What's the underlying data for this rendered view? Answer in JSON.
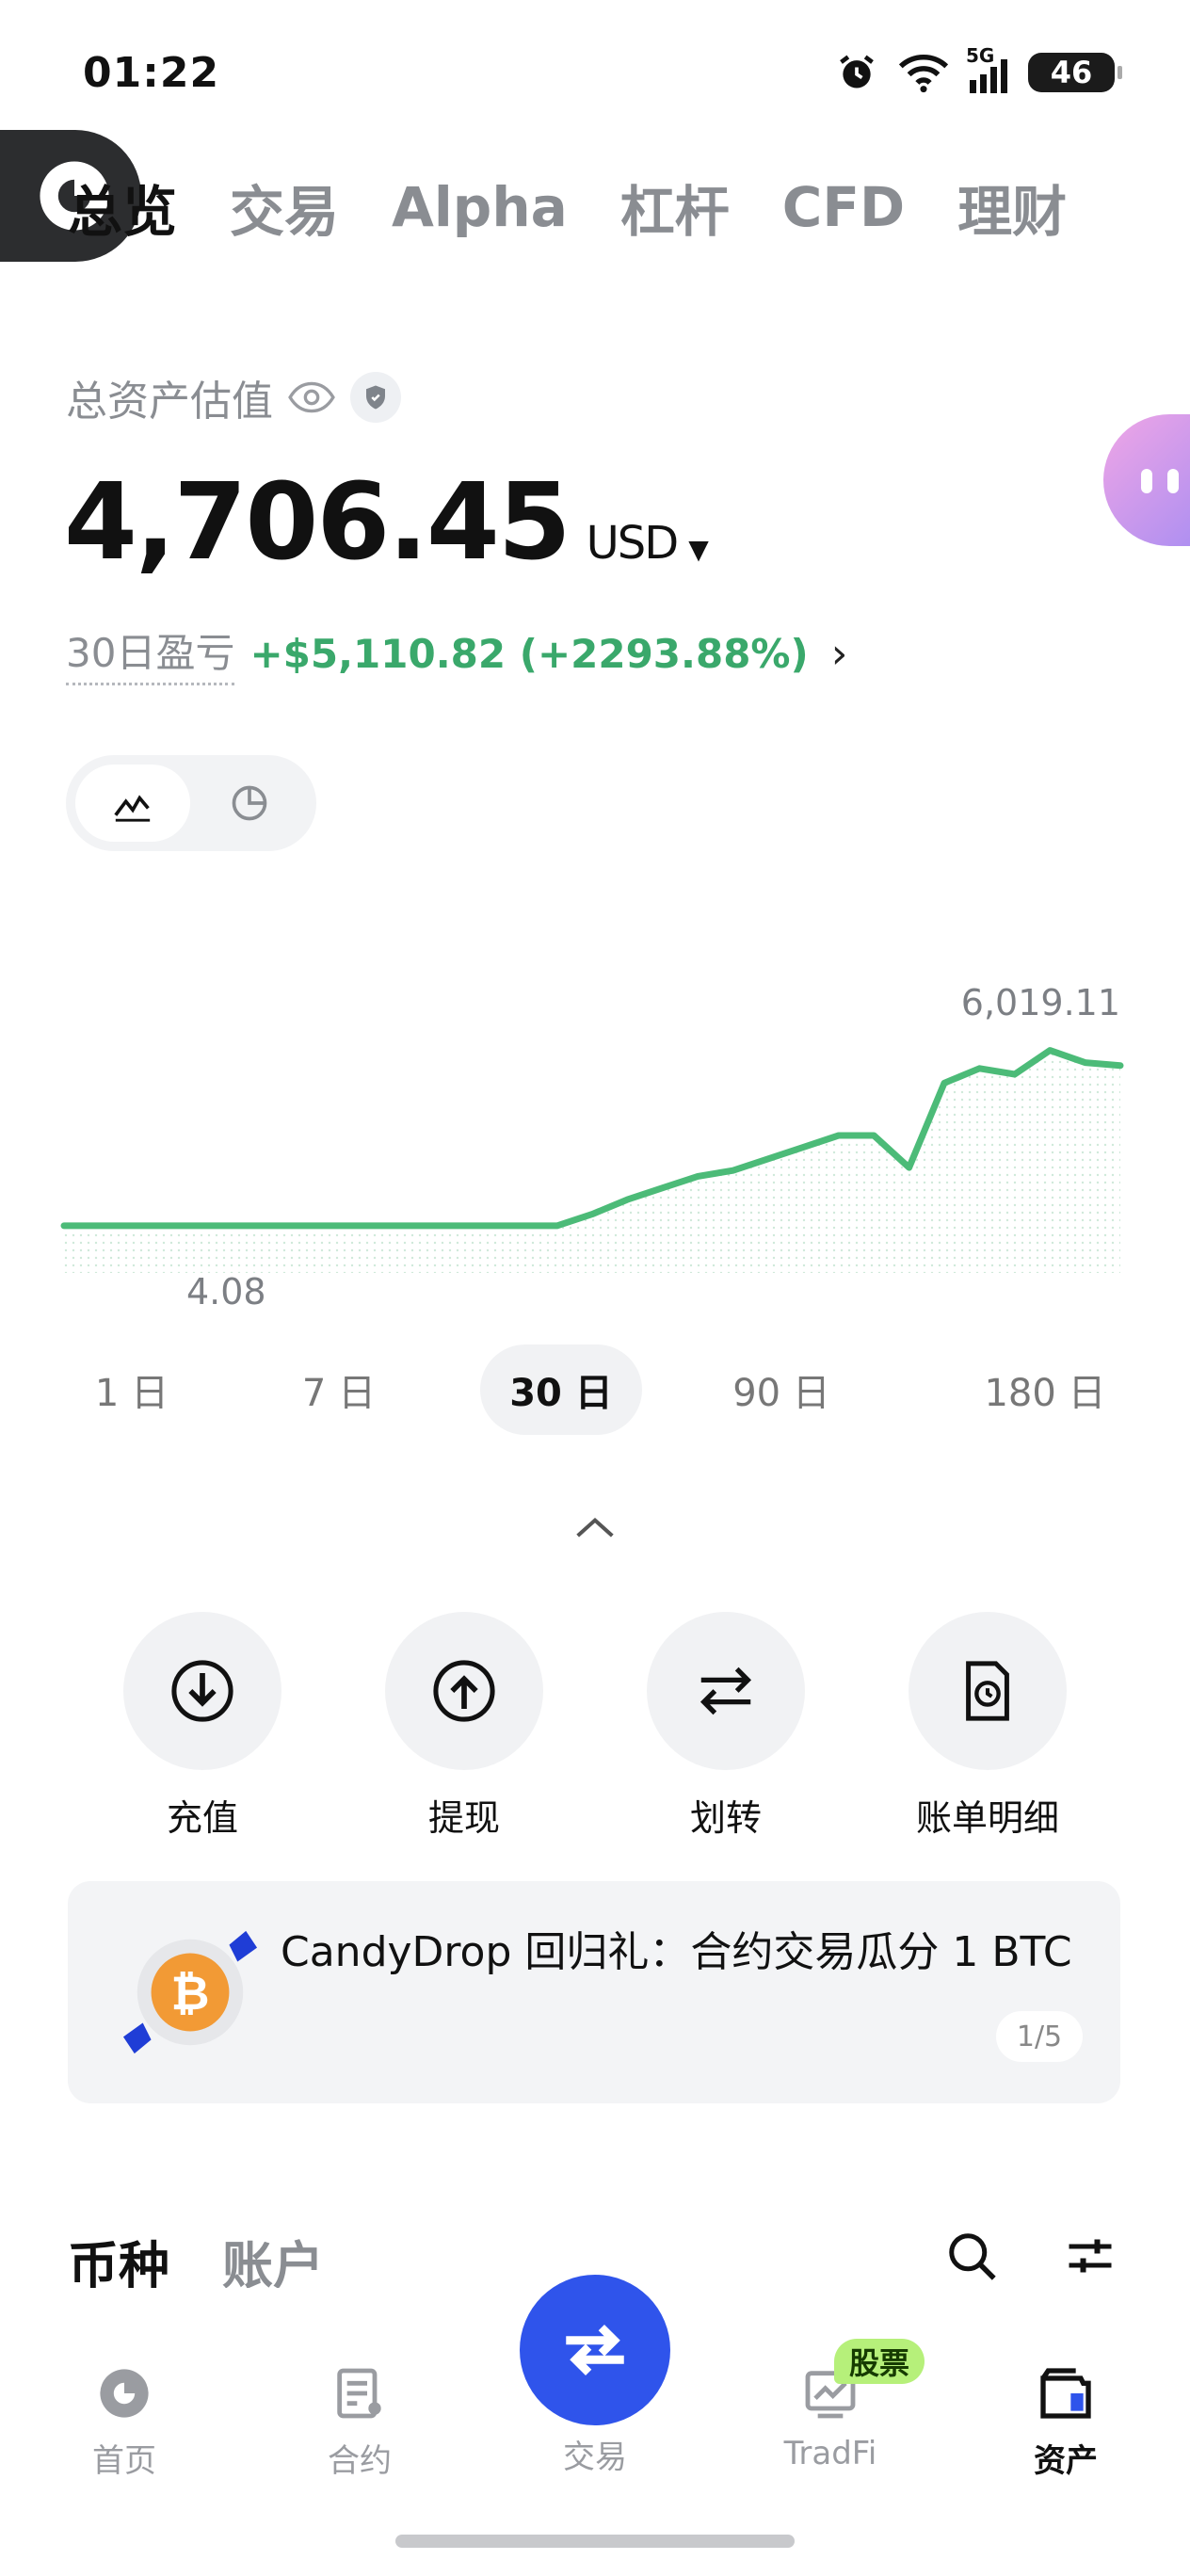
{
  "status_bar": {
    "time": "01:22",
    "network": "5G",
    "battery": "46"
  },
  "top_tabs": [
    {
      "label": "总览",
      "active": true
    },
    {
      "label": "交易",
      "active": false
    },
    {
      "label": "Alpha",
      "active": false
    },
    {
      "label": "杠杆",
      "active": false
    },
    {
      "label": "CFD",
      "active": false
    },
    {
      "label": "理财",
      "active": false
    }
  ],
  "asset": {
    "title": "总资产估值",
    "amount": "4,706.45",
    "currency": "USD",
    "pnl_label": "30日盈亏",
    "pnl_value": "+$5,110.82 (+2293.88%)"
  },
  "chart": {
    "max_label": "6,019.11",
    "min_label": "4.08",
    "line_color": "#4cbb78"
  },
  "chart_data": {
    "type": "line",
    "x": [
      0,
      1,
      2,
      3,
      4,
      5,
      6,
      7,
      8,
      9,
      10,
      11,
      12,
      13,
      14,
      15,
      16,
      17,
      18,
      19,
      20,
      21,
      22,
      23,
      24,
      25,
      26,
      27,
      28,
      29,
      30
    ],
    "values": [
      4.08,
      4.08,
      4.08,
      4.08,
      4.08,
      4.08,
      4.08,
      4.08,
      4.08,
      4.08,
      4.08,
      4.08,
      4.08,
      4.08,
      4.08,
      400,
      900,
      1300,
      1700,
      1900,
      2300,
      2700,
      3100,
      3100,
      2000,
      4900,
      5400,
      5200,
      6019.11,
      5600,
      5500
    ],
    "ylim": [
      0,
      6200
    ],
    "grid": false
  },
  "periods": [
    {
      "label": "1 日",
      "active": false
    },
    {
      "label": "7 日",
      "active": false
    },
    {
      "label": "30 日",
      "active": true
    },
    {
      "label": "90 日",
      "active": false
    },
    {
      "label": "180 日",
      "active": false
    }
  ],
  "actions": [
    {
      "label": "充值",
      "icon": "download-icon"
    },
    {
      "label": "提现",
      "icon": "upload-icon"
    },
    {
      "label": "划转",
      "icon": "transfer-icon"
    },
    {
      "label": "账单明细",
      "icon": "bill-icon"
    }
  ],
  "banner": {
    "text": "CandyDrop 回归礼：合约交易瓜分 1 BTC",
    "page": "1/5"
  },
  "asset_tabs": {
    "coin": "币种",
    "account": "账户"
  },
  "bottom_nav": [
    {
      "label": "首页",
      "icon": "home-icon"
    },
    {
      "label": "合约",
      "icon": "contract-icon"
    },
    {
      "label": "交易",
      "icon": "trade-icon"
    },
    {
      "label": "TradFi",
      "icon": "tradfi-icon",
      "badge": "股票"
    },
    {
      "label": "资产",
      "icon": "wallet-icon",
      "active": true
    }
  ],
  "colors": {
    "accent": "#2f54eb",
    "profit": "#3aa86b",
    "badge": "#b6f07a"
  }
}
